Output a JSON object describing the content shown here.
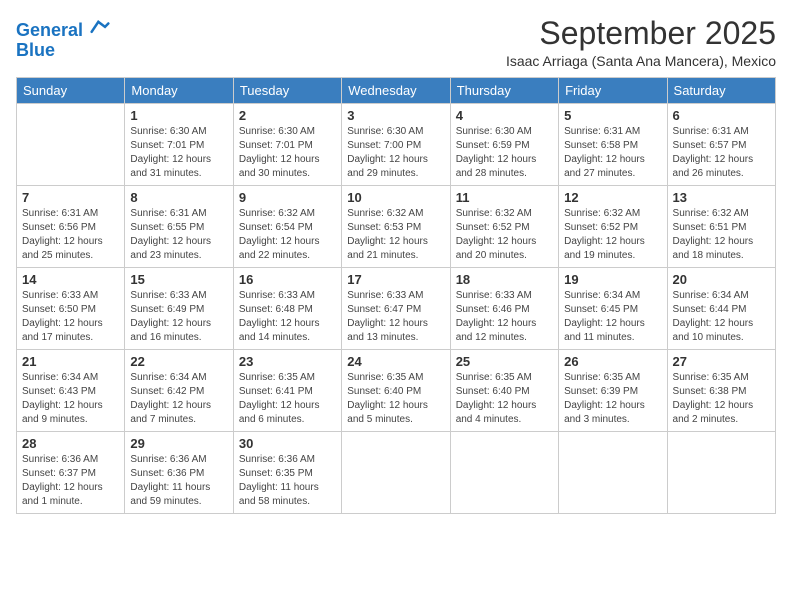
{
  "logo": {
    "line1": "General",
    "line2": "Blue"
  },
  "title": "September 2025",
  "subtitle": "Isaac Arriaga (Santa Ana Mancera), Mexico",
  "days_header": [
    "Sunday",
    "Monday",
    "Tuesday",
    "Wednesday",
    "Thursday",
    "Friday",
    "Saturday"
  ],
  "weeks": [
    [
      {
        "num": "",
        "info": ""
      },
      {
        "num": "1",
        "info": "Sunrise: 6:30 AM\nSunset: 7:01 PM\nDaylight: 12 hours\nand 31 minutes."
      },
      {
        "num": "2",
        "info": "Sunrise: 6:30 AM\nSunset: 7:01 PM\nDaylight: 12 hours\nand 30 minutes."
      },
      {
        "num": "3",
        "info": "Sunrise: 6:30 AM\nSunset: 7:00 PM\nDaylight: 12 hours\nand 29 minutes."
      },
      {
        "num": "4",
        "info": "Sunrise: 6:30 AM\nSunset: 6:59 PM\nDaylight: 12 hours\nand 28 minutes."
      },
      {
        "num": "5",
        "info": "Sunrise: 6:31 AM\nSunset: 6:58 PM\nDaylight: 12 hours\nand 27 minutes."
      },
      {
        "num": "6",
        "info": "Sunrise: 6:31 AM\nSunset: 6:57 PM\nDaylight: 12 hours\nand 26 minutes."
      }
    ],
    [
      {
        "num": "7",
        "info": "Sunrise: 6:31 AM\nSunset: 6:56 PM\nDaylight: 12 hours\nand 25 minutes."
      },
      {
        "num": "8",
        "info": "Sunrise: 6:31 AM\nSunset: 6:55 PM\nDaylight: 12 hours\nand 23 minutes."
      },
      {
        "num": "9",
        "info": "Sunrise: 6:32 AM\nSunset: 6:54 PM\nDaylight: 12 hours\nand 22 minutes."
      },
      {
        "num": "10",
        "info": "Sunrise: 6:32 AM\nSunset: 6:53 PM\nDaylight: 12 hours\nand 21 minutes."
      },
      {
        "num": "11",
        "info": "Sunrise: 6:32 AM\nSunset: 6:52 PM\nDaylight: 12 hours\nand 20 minutes."
      },
      {
        "num": "12",
        "info": "Sunrise: 6:32 AM\nSunset: 6:52 PM\nDaylight: 12 hours\nand 19 minutes."
      },
      {
        "num": "13",
        "info": "Sunrise: 6:32 AM\nSunset: 6:51 PM\nDaylight: 12 hours\nand 18 minutes."
      }
    ],
    [
      {
        "num": "14",
        "info": "Sunrise: 6:33 AM\nSunset: 6:50 PM\nDaylight: 12 hours\nand 17 minutes."
      },
      {
        "num": "15",
        "info": "Sunrise: 6:33 AM\nSunset: 6:49 PM\nDaylight: 12 hours\nand 16 minutes."
      },
      {
        "num": "16",
        "info": "Sunrise: 6:33 AM\nSunset: 6:48 PM\nDaylight: 12 hours\nand 14 minutes."
      },
      {
        "num": "17",
        "info": "Sunrise: 6:33 AM\nSunset: 6:47 PM\nDaylight: 12 hours\nand 13 minutes."
      },
      {
        "num": "18",
        "info": "Sunrise: 6:33 AM\nSunset: 6:46 PM\nDaylight: 12 hours\nand 12 minutes."
      },
      {
        "num": "19",
        "info": "Sunrise: 6:34 AM\nSunset: 6:45 PM\nDaylight: 12 hours\nand 11 minutes."
      },
      {
        "num": "20",
        "info": "Sunrise: 6:34 AM\nSunset: 6:44 PM\nDaylight: 12 hours\nand 10 minutes."
      }
    ],
    [
      {
        "num": "21",
        "info": "Sunrise: 6:34 AM\nSunset: 6:43 PM\nDaylight: 12 hours\nand 9 minutes."
      },
      {
        "num": "22",
        "info": "Sunrise: 6:34 AM\nSunset: 6:42 PM\nDaylight: 12 hours\nand 7 minutes."
      },
      {
        "num": "23",
        "info": "Sunrise: 6:35 AM\nSunset: 6:41 PM\nDaylight: 12 hours\nand 6 minutes."
      },
      {
        "num": "24",
        "info": "Sunrise: 6:35 AM\nSunset: 6:40 PM\nDaylight: 12 hours\nand 5 minutes."
      },
      {
        "num": "25",
        "info": "Sunrise: 6:35 AM\nSunset: 6:40 PM\nDaylight: 12 hours\nand 4 minutes."
      },
      {
        "num": "26",
        "info": "Sunrise: 6:35 AM\nSunset: 6:39 PM\nDaylight: 12 hours\nand 3 minutes."
      },
      {
        "num": "27",
        "info": "Sunrise: 6:35 AM\nSunset: 6:38 PM\nDaylight: 12 hours\nand 2 minutes."
      }
    ],
    [
      {
        "num": "28",
        "info": "Sunrise: 6:36 AM\nSunset: 6:37 PM\nDaylight: 12 hours\nand 1 minute."
      },
      {
        "num": "29",
        "info": "Sunrise: 6:36 AM\nSunset: 6:36 PM\nDaylight: 11 hours\nand 59 minutes."
      },
      {
        "num": "30",
        "info": "Sunrise: 6:36 AM\nSunset: 6:35 PM\nDaylight: 11 hours\nand 58 minutes."
      },
      {
        "num": "",
        "info": ""
      },
      {
        "num": "",
        "info": ""
      },
      {
        "num": "",
        "info": ""
      },
      {
        "num": "",
        "info": ""
      }
    ]
  ]
}
